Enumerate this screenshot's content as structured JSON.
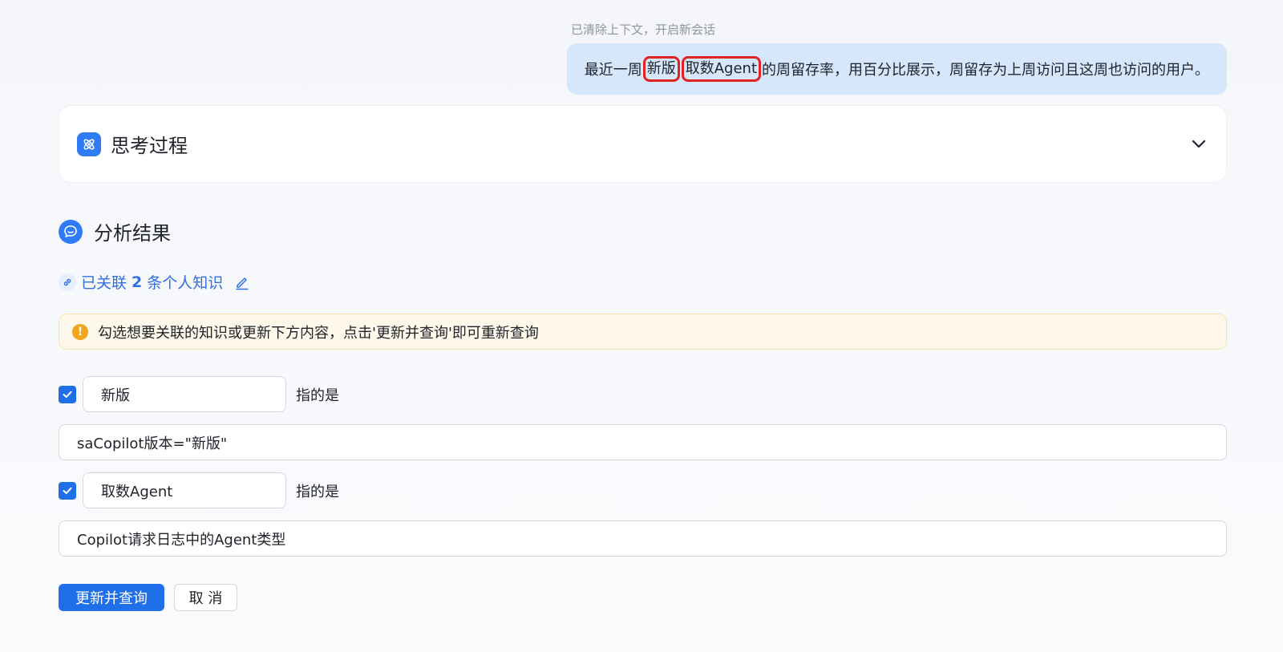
{
  "system_note": "已清除上下文，开启新会话",
  "user_message": {
    "prefix": "最近一周",
    "highlight_1": "新版",
    "highlight_2": "取数Agent",
    "suffix": "的周留存率，用百分比展示，周留存为上周访问且这周也访问的用户。"
  },
  "thinking": {
    "title": "思考过程",
    "icon": "atom-icon",
    "toggle_icon": "chevron-down-icon"
  },
  "result": {
    "title": "分析结果",
    "icon": "chat-bubble-icon"
  },
  "linked_knowledge": {
    "prefix": "已关联",
    "count": "2",
    "suffix": "条个人知识",
    "icon": "link-icon",
    "edit_icon": "edit-icon"
  },
  "notice": {
    "icon": "warning-icon",
    "text": "勾选想要关联的知识或更新下方内容，点击'更新并查询'即可重新查询"
  },
  "terms": [
    {
      "checked": true,
      "term": "新版",
      "suffix": "指的是",
      "definition": "saCopilot版本=\"新版\""
    },
    {
      "checked": true,
      "term": "取数Agent",
      "suffix": "指的是",
      "definition": "Copilot请求日志中的Agent类型"
    }
  ],
  "buttons": {
    "submit": "更新并查询",
    "cancel": "取 消"
  },
  "colors": {
    "primary": "#1f6fe8",
    "highlight_border": "#e02424",
    "bubble": "#d6e6fb",
    "warning": "#f0a71c"
  }
}
